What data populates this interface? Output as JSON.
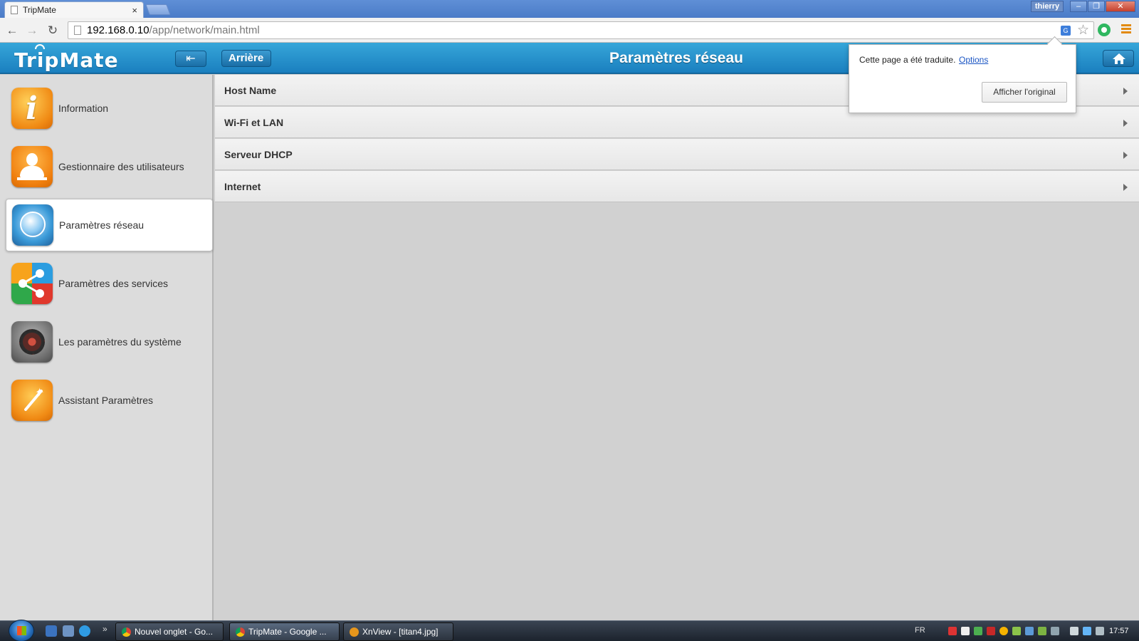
{
  "browser": {
    "tab_title": "TripMate",
    "tab_close": "×",
    "user": "thierry",
    "url_host": "192.168.0.10",
    "url_path": "/app/network/main.html"
  },
  "header": {
    "logo": "TripMate",
    "back_label": "Arrière",
    "title": "Paramètres réseau"
  },
  "translate_bubble": {
    "message": "Cette page a été traduite.",
    "options_link": "Options",
    "show_original": "Afficher l'original"
  },
  "sidebar": {
    "items": [
      {
        "label": "Information",
        "icon": "info-icon"
      },
      {
        "label": "Gestionnaire des utilisateurs",
        "icon": "user-icon"
      },
      {
        "label": "Paramètres réseau",
        "icon": "globe-icon",
        "active": true
      },
      {
        "label": "Paramètres des services",
        "icon": "share-icon"
      },
      {
        "label": "Les paramètres du système",
        "icon": "gear-icon"
      },
      {
        "label": "Assistant Paramètres",
        "icon": "wand-icon"
      }
    ]
  },
  "network_list": [
    {
      "label": "Host Name"
    },
    {
      "label": "Wi-Fi et LAN"
    },
    {
      "label": "Serveur DHCP"
    },
    {
      "label": "Internet"
    }
  ],
  "taskbar": {
    "tasks": [
      {
        "label": "Nouvel onglet - Go..."
      },
      {
        "label": "TripMate - Google ..."
      },
      {
        "label": "XnView - [titan4.jpg]"
      }
    ],
    "language": "FR",
    "clock": "17:57"
  },
  "colors": {
    "header_blue": "#1a7fbf",
    "sidebar_bg": "#dcdcdc",
    "content_bg": "#d1d1d1",
    "link_blue": "#1a55c4"
  }
}
